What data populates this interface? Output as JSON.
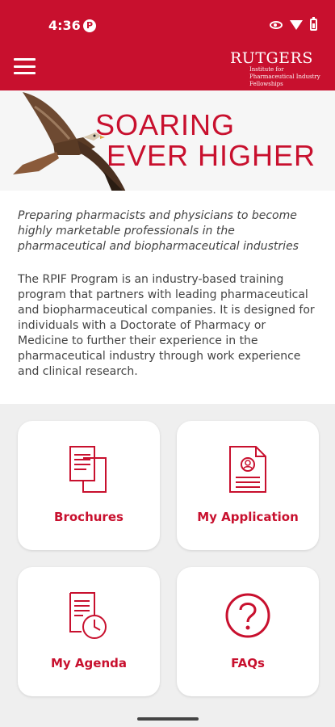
{
  "status_bar": {
    "time": "4:36",
    "notif_letter": "P"
  },
  "logo": {
    "title": "RUTGERS",
    "subtitle": "Institute for Pharmaceutical Industry Fellowships"
  },
  "hero": {
    "line1": "SOARING",
    "line2": "EVER HIGHER"
  },
  "intro": {
    "tagline": "Preparing pharmacists and physicians to become highly marketable professionals in the pharmaceutical and biopharmaceutical industries",
    "description": "The RPIF Program is an industry-based training program that partners with leading pharmaceutical and biopharmaceutical companies. It is designed for individuals with a Doctorate of Pharmacy or Medicine to further their experience in the pharmaceutical industry through work experience and clinical research."
  },
  "cards": [
    {
      "label": "Brochures",
      "icon": "brochure-icon"
    },
    {
      "label": "My Application",
      "icon": "application-icon"
    },
    {
      "label": "My Agenda",
      "icon": "agenda-icon"
    },
    {
      "label": "FAQs",
      "icon": "faq-icon"
    }
  ],
  "colors": {
    "brand": "#c8102e",
    "background": "#efefef"
  }
}
